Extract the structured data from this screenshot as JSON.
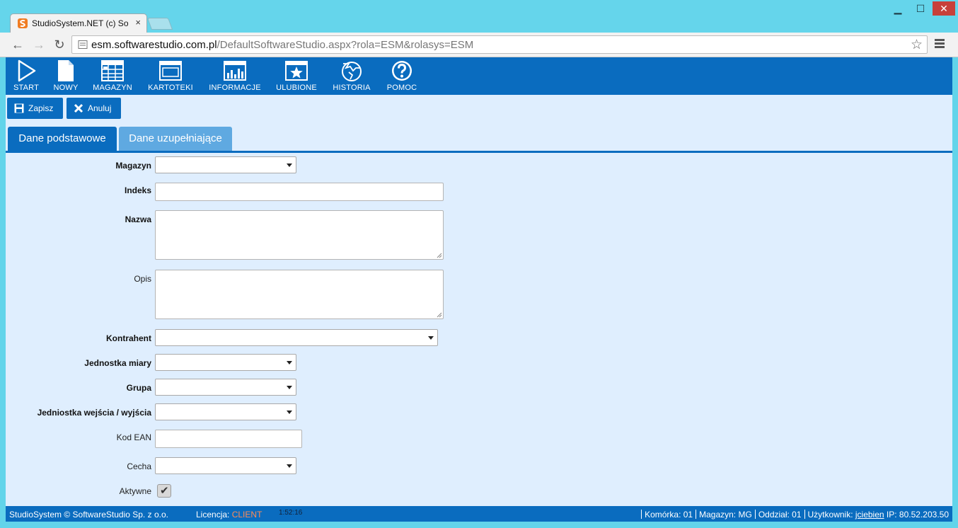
{
  "browser": {
    "tab_title": "StudioSystem.NET (c) Soft",
    "tab_close": "×",
    "url_host": "esm.softwarestudio.com.pl",
    "url_rest": "/DefaultSoftwareStudio.aspx?rola=ESM&rolasys=ESM",
    "window_controls": {
      "minimize": "▁",
      "maximize": "☐",
      "close": "✕"
    }
  },
  "toolbar": {
    "items": [
      {
        "label": "START",
        "icon": "play-icon"
      },
      {
        "label": "NOWY",
        "icon": "document-icon"
      },
      {
        "label": "MAGAZYN",
        "icon": "grid-icon"
      },
      {
        "label": "KARTOTEKI",
        "icon": "window-icon"
      },
      {
        "label": "INFORMACJE",
        "icon": "bar-chart-icon"
      },
      {
        "label": "ULUBIONE",
        "icon": "star-icon"
      },
      {
        "label": "HISTORIA",
        "icon": "history-icon"
      },
      {
        "label": "POMOC",
        "icon": "help-icon"
      }
    ]
  },
  "actions": {
    "save": "Zapisz",
    "cancel": "Anuluj"
  },
  "tabs": {
    "basic": "Dane podstawowe",
    "extra": "Dane uzupełniające"
  },
  "form": {
    "magazyn": {
      "label": "Magazyn",
      "value": ""
    },
    "indeks": {
      "label": "Indeks",
      "value": ""
    },
    "nazwa": {
      "label": "Nazwa",
      "value": ""
    },
    "opis": {
      "label": "Opis",
      "value": ""
    },
    "kontrahent": {
      "label": "Kontrahent",
      "value": ""
    },
    "jednostka": {
      "label": "Jednostka miary",
      "value": ""
    },
    "grupa": {
      "label": "Grupa",
      "value": ""
    },
    "jednostka_we_wy": {
      "label": "Jedniostka wejścia / wyjścia",
      "value": ""
    },
    "kod_ean": {
      "label": "Kod EAN",
      "value": ""
    },
    "cecha": {
      "label": "Cecha",
      "value": ""
    },
    "aktywne": {
      "label": "Aktywne",
      "checked": true
    }
  },
  "status": {
    "copyright": "StudioSystem © SoftwareStudio Sp. z o.o.",
    "license_label": "Licencja:",
    "license_value": "CLIENT",
    "time": "1:52:16",
    "komorka": "Komórka: 01",
    "magazyn": "Magazyn: MG",
    "oddzial": "Oddział: 01",
    "user_label": "Użytkownik:",
    "user": "jciebien",
    "ip": "IP: 80.52.203.50"
  },
  "colors": {
    "accent": "#0a6cbf",
    "content_bg": "#dfeefe",
    "tab_inactive": "#5fa9e1",
    "license": "#ff8b57",
    "chrome": "#62d4ea"
  }
}
